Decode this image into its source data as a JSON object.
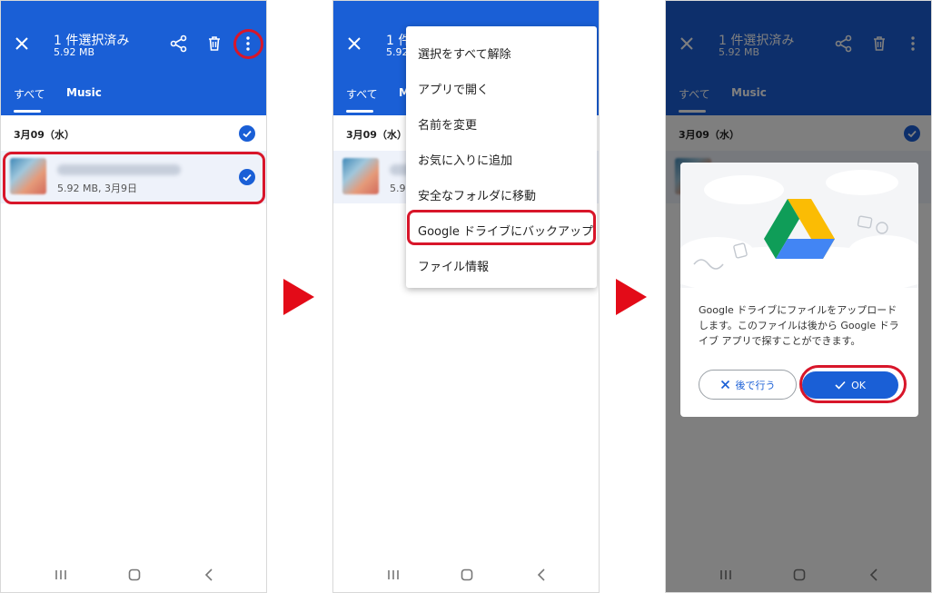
{
  "colors": {
    "appbar": "#1a5fd6",
    "highlight": "#d8162a",
    "arrow": "#e30b18"
  },
  "selection": {
    "title": "1 件選択済み",
    "size": "5.92 MB"
  },
  "tabs": {
    "all": "すべて",
    "music": "Music"
  },
  "list": {
    "date": "3月09（水）",
    "file_meta": "5.92 MB, 3月9日"
  },
  "menu": {
    "items": [
      "選択をすべて解除",
      "アプリで開く",
      "名前を変更",
      "お気に入りに追加",
      "安全なフォルダに移動",
      "Google ドライブにバックアップ",
      "ファイル情報"
    ]
  },
  "dialog": {
    "message_lines": [
      "Google ドライブにファイルをアップロード",
      "します。このファイルは後から Google ドラ",
      "イブ アプリで探すことができます。"
    ],
    "later_label": "後で行う",
    "ok_label": "OK"
  },
  "icons": [
    "close-icon",
    "share-icon",
    "delete-icon",
    "more-vert-icon",
    "check-circle-icon",
    "recent-apps-icon",
    "home-icon",
    "back-icon",
    "google-drive-logo",
    "next-step-arrow"
  ]
}
